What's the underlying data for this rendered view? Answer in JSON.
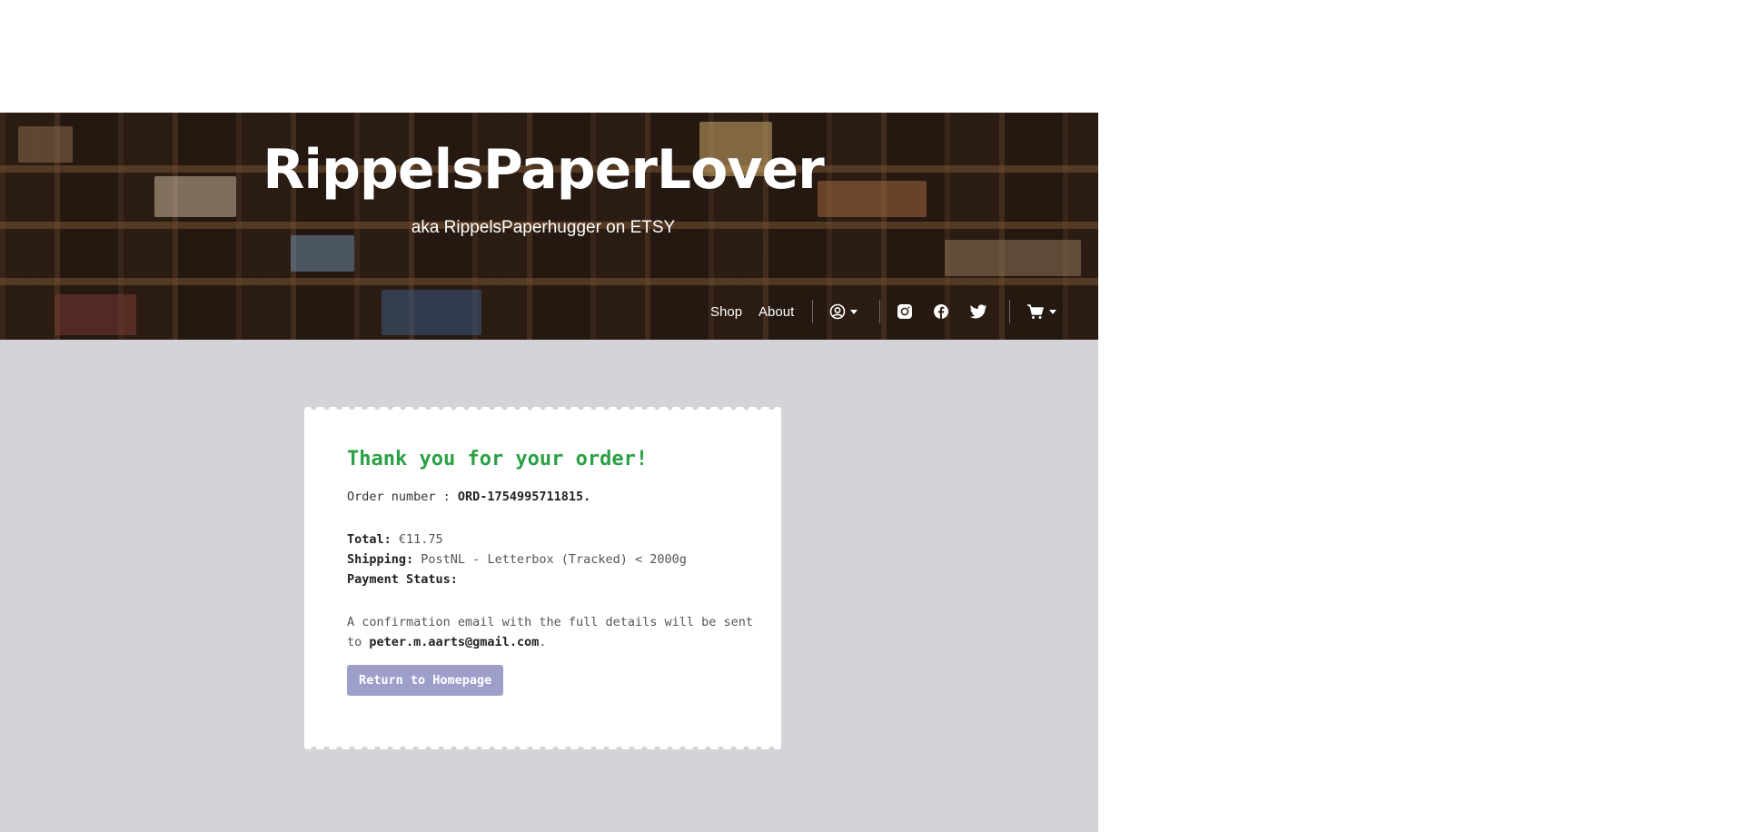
{
  "header": {
    "title": "RippelsPaperLover",
    "subtitle": "aka RippelsPaperhugger on ETSY"
  },
  "nav": {
    "links": [
      "Shop",
      "About"
    ],
    "icons": [
      "account-icon",
      "instagram-icon",
      "facebook-icon",
      "twitter-icon",
      "cart-icon"
    ]
  },
  "order": {
    "heading": "Thank you for your order!",
    "number_label": "Order number : ",
    "number_value": "ORD-1754995711815.",
    "total_label": "Total:",
    "total_value": "€11.75",
    "shipping_label": "Shipping:",
    "shipping_value": "PostNL - Letterbox (Tracked) < 2000g",
    "payment_label": "Payment Status:",
    "payment_value": "",
    "confirm_text": "A confirmation email with the full details will be sent to ",
    "email": "peter.m.aarts@gmail.com",
    "confirm_end": ".",
    "button_label": "Return to Homepage"
  },
  "colors": {
    "accent_green": "#2aa045",
    "button": "#9e9ecb",
    "page_bg": "#d4d3d8"
  }
}
